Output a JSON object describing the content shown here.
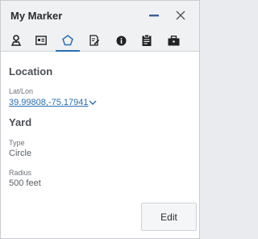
{
  "window": {
    "title": "My Marker"
  },
  "header_icons": {
    "minimize": "minimize-icon",
    "close": "close-icon"
  },
  "tabs": [
    {
      "icon": "location-pin-icon",
      "active": false
    },
    {
      "icon": "id-card-icon",
      "active": false
    },
    {
      "icon": "pentagon-shape-icon",
      "active": true
    },
    {
      "icon": "edit-document-icon",
      "active": false
    },
    {
      "icon": "info-icon",
      "active": false
    },
    {
      "icon": "clipboard-icon",
      "active": false
    },
    {
      "icon": "briefcase-icon",
      "active": false
    }
  ],
  "location": {
    "heading": "Location",
    "latlon_label": "Lat/Lon",
    "latlon_value": "39.99808,-75.17941"
  },
  "yard": {
    "heading": "Yard",
    "type_label": "Type",
    "type_value": "Circle",
    "radius_label": "Radius",
    "radius_value": "500 feet"
  },
  "actions": {
    "edit_label": "Edit"
  },
  "colors": {
    "accent": "#2a6fb0",
    "header_bg": "#f0f1f3",
    "text": "#2b2b2b"
  }
}
